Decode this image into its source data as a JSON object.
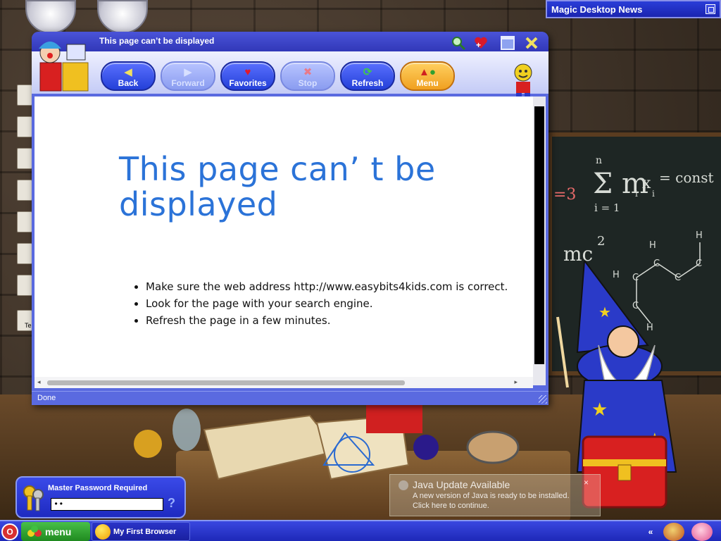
{
  "desktop": {
    "news_bar": {
      "title": "Magic Desktop News"
    },
    "side_label": "Te",
    "chalkboard": {
      "eq1": "=3",
      "eq2": "Σ m",
      "eq3": "i",
      "eq4": "x",
      "eq5": "i",
      "eq6": "= const",
      "eq7": "n",
      "eq8": "i = 1",
      "eq9": "mc",
      "eq10": "2"
    }
  },
  "browser": {
    "title": "This page can’t be displayed",
    "toolbar": {
      "back": "Back",
      "forward": "Forward",
      "favorites": "Favorites",
      "stop": "Stop",
      "refresh": "Refresh",
      "menu": "Menu"
    },
    "content": {
      "heading": "This page can’ t be displayed",
      "bullets": [
        "Make sure the web address http://www.easybits4kids.com is correct.",
        "Look for the page with your search engine.",
        "Refresh the page in a few minutes."
      ]
    },
    "status": "Done"
  },
  "password_panel": {
    "title": "Master Password Required",
    "value": "••",
    "help": "?"
  },
  "java_notice": {
    "title": "Java Update Available",
    "line1": "A new version of Java is ready to be installed.",
    "line2": "Click here to continue.",
    "close": "×"
  },
  "taskbar": {
    "power": "O",
    "menu_label": "menu",
    "task_item": "My First Browser",
    "tray_arrow": "«"
  }
}
